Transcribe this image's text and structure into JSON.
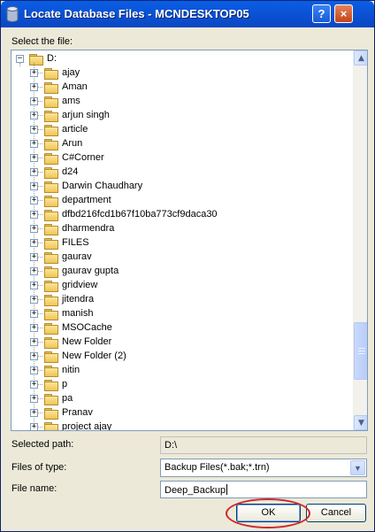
{
  "window": {
    "title": "Locate Database Files - MCNDESKTOP05",
    "help_label": "?",
    "close_label": "×"
  },
  "select_label": "Select the file:",
  "tree": {
    "root": "D:",
    "items": [
      "ajay",
      "Aman",
      "ams",
      "arjun singh",
      "article",
      "Arun",
      "C#Corner",
      "d24",
      "Darwin Chaudhary",
      "department",
      "dfbd216fcd1b67f10ba773cf9daca30",
      "dharmendra",
      "FILES",
      "gaurav",
      "gaurav gupta",
      "gridview",
      "jitendra",
      "manish",
      "MSOCache",
      "New Folder",
      "New Folder (2)",
      "nitin",
      "p",
      "pa",
      "Pranav",
      "project ajay"
    ]
  },
  "selected_path": {
    "label": "Selected path:",
    "value": "D:\\"
  },
  "files_of_type": {
    "label": "Files of type:",
    "value": "Backup Files(*.bak;*.trn)"
  },
  "file_name": {
    "label": "File name:",
    "value": "Deep_Backup"
  },
  "buttons": {
    "ok": "OK",
    "cancel": "Cancel"
  },
  "colors": {
    "title_bar": "#0a54d8",
    "highlight_ring": "#d0262a",
    "dialog_bg": "#ece9d8"
  }
}
